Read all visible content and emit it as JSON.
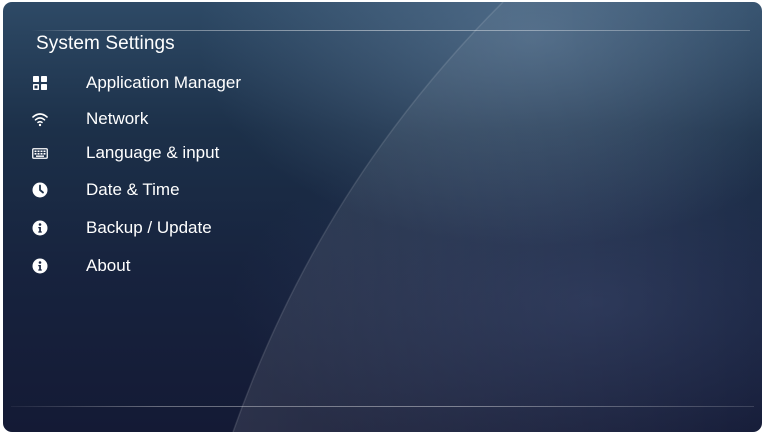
{
  "screen": {
    "title": "System Settings"
  },
  "menu": {
    "items": [
      {
        "label": "Application Manager",
        "icon": "apps-grid-icon"
      },
      {
        "label": "Network",
        "icon": "wifi-icon"
      },
      {
        "label": "Language & input",
        "icon": "keyboard-icon"
      },
      {
        "label": "Date & Time",
        "icon": "clock-icon"
      },
      {
        "label": "Backup / Update",
        "icon": "info-icon"
      },
      {
        "label": "About",
        "icon": "info-icon"
      }
    ]
  },
  "colors": {
    "background_top": "#2e4a66",
    "background_bottom": "#141a35",
    "text": "#ffffff"
  }
}
